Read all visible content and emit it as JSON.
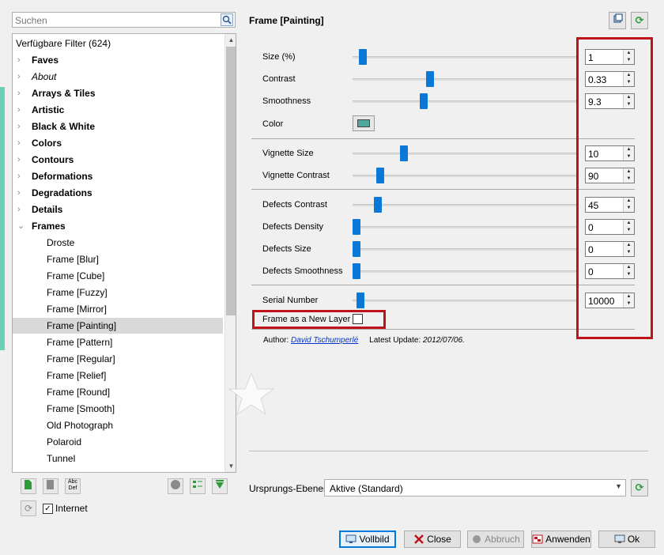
{
  "search": {
    "placeholder": "Suchen"
  },
  "tree": {
    "header": "Verfügbare Filter (624)",
    "categories": [
      "Faves",
      "About",
      "Arrays & Tiles",
      "Artistic",
      "Black & White",
      "Colors",
      "Contours",
      "Deformations",
      "Degradations",
      "Details",
      "Frames"
    ],
    "frames_children": [
      "Droste",
      "Frame [Blur]",
      "Frame [Cube]",
      "Frame [Fuzzy]",
      "Frame [Mirror]",
      "Frame [Painting]",
      "Frame [Pattern]",
      "Frame [Regular]",
      "Frame [Relief]",
      "Frame [Round]",
      "Frame [Smooth]",
      "Old Photograph",
      "Polaroid",
      "Tunnel"
    ],
    "selected": "Frame [Painting]"
  },
  "internet_label": "Internet",
  "internet_checked": true,
  "filter": {
    "title": "Frame [Painting]",
    "params": [
      {
        "label": "Size (%)",
        "value": "1",
        "level": 0.03
      },
      {
        "label": "Contrast",
        "value": "0.33",
        "level": 0.34
      },
      {
        "label": "Smoothness",
        "value": "9.3",
        "level": 0.31
      },
      {
        "label": "Vignette Size",
        "value": "10",
        "level": 0.22
      },
      {
        "label": "Vignette Contrast",
        "value": "90",
        "level": 0.11
      },
      {
        "label": "Defects Contrast",
        "value": "45",
        "level": 0.1
      },
      {
        "label": "Defects Density",
        "value": "0",
        "level": 0.0
      },
      {
        "label": "Defects Size",
        "value": "0",
        "level": 0.0
      },
      {
        "label": "Defects Smoothness",
        "value": "0",
        "level": 0.0
      },
      {
        "label": "Serial Number",
        "value": "10000",
        "level": 0.02
      }
    ],
    "color_label": "Color",
    "color_value": "#4fa89a",
    "new_layer_label": "Frame as a New Layer",
    "new_layer_checked": false,
    "author_prefix": "Author:",
    "author_name": "David Tschumperlé",
    "update_prefix": "Latest Update:",
    "update_date": "2012/07/06."
  },
  "input_layers": {
    "label": "Ursprungs-Ebenen",
    "value": "Aktive (Standard)"
  },
  "buttons": {
    "fullscreen": "Vollbild",
    "close": "Close",
    "abort": "Abbruch",
    "apply": "Anwenden",
    "ok": "Ok"
  },
  "accent": "#0a78d7",
  "highlight": "#c0121b"
}
